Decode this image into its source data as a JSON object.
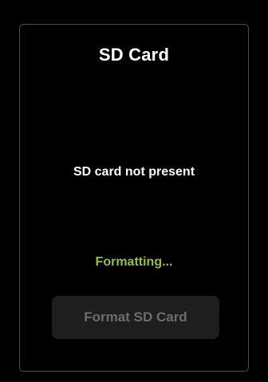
{
  "dialog": {
    "title": "SD Card",
    "status_message": "SD card not present",
    "progress_message": "Formatting...",
    "format_button_label": "Format SD Card",
    "format_button_state": "disabled"
  },
  "colors": {
    "background": "#000000",
    "panel_border": "#4a4a4a",
    "primary_text": "#ffffff",
    "progress_text": "#8fbf4f",
    "button_bg": "#1e1e1e",
    "button_text_disabled": "#6d6d6d"
  }
}
